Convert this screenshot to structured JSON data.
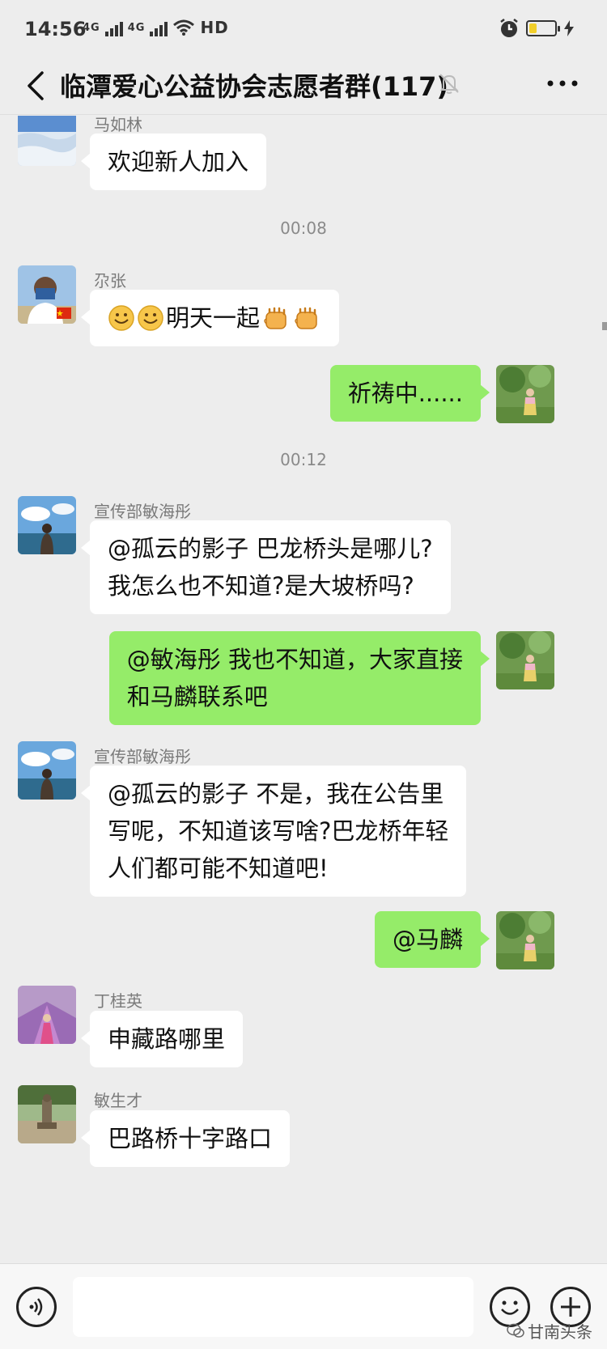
{
  "status_bar": {
    "time": "14:56",
    "signal1": "4G",
    "signal2": "4G",
    "hd": "HD",
    "battery_level": 0.3,
    "battery_color": "#f2cf2a"
  },
  "header": {
    "title": "临潭爱心公益协会志愿者群(117)",
    "icons": [
      "back-arrow-icon",
      "mute-bell-icon",
      "more-dots-icon"
    ]
  },
  "messages": [
    {
      "type": "incoming",
      "sender": "马如林",
      "text": "欢迎新人加入"
    },
    {
      "type": "timestamp",
      "text": "00:08"
    },
    {
      "type": "incoming",
      "sender": "尕张",
      "text": "明天一起",
      "emojis_before": [
        "smile-emoji",
        "smile-emoji"
      ],
      "emojis_after": [
        "fist-emoji",
        "fist-emoji"
      ]
    },
    {
      "type": "outgoing",
      "text": "祈祷中......"
    },
    {
      "type": "timestamp",
      "text": "00:12"
    },
    {
      "type": "incoming",
      "sender": "宣传部敏海彤",
      "lines": [
        "@孤云的影子  巴龙桥头是哪儿?",
        "我怎么也不知道?是大坡桥吗?"
      ]
    },
    {
      "type": "outgoing",
      "lines": [
        "@敏海彤  我也不知道，大家直接",
        "和马麟联系吧"
      ]
    },
    {
      "type": "incoming",
      "sender": "宣传部敏海彤",
      "lines": [
        "@孤云的影子  不是，我在公告里",
        "写呢，不知道该写啥?巴龙桥年轻",
        "人们都可能不知道吧!"
      ]
    },
    {
      "type": "outgoing",
      "text": "@马麟"
    },
    {
      "type": "incoming",
      "sender": "丁桂英",
      "text": "申藏路哪里"
    },
    {
      "type": "incoming",
      "sender": "敏生才",
      "text": "巴路桥十字路口"
    }
  ],
  "input_bar": {
    "text_value": "",
    "icons": [
      "voice-icon",
      "emoji-icon",
      "plus-icon"
    ]
  },
  "watermark": "甘南头条",
  "colors": {
    "background": "#ededed",
    "outgoing_bubble": "#95ec69",
    "incoming_bubble": "#ffffff"
  }
}
